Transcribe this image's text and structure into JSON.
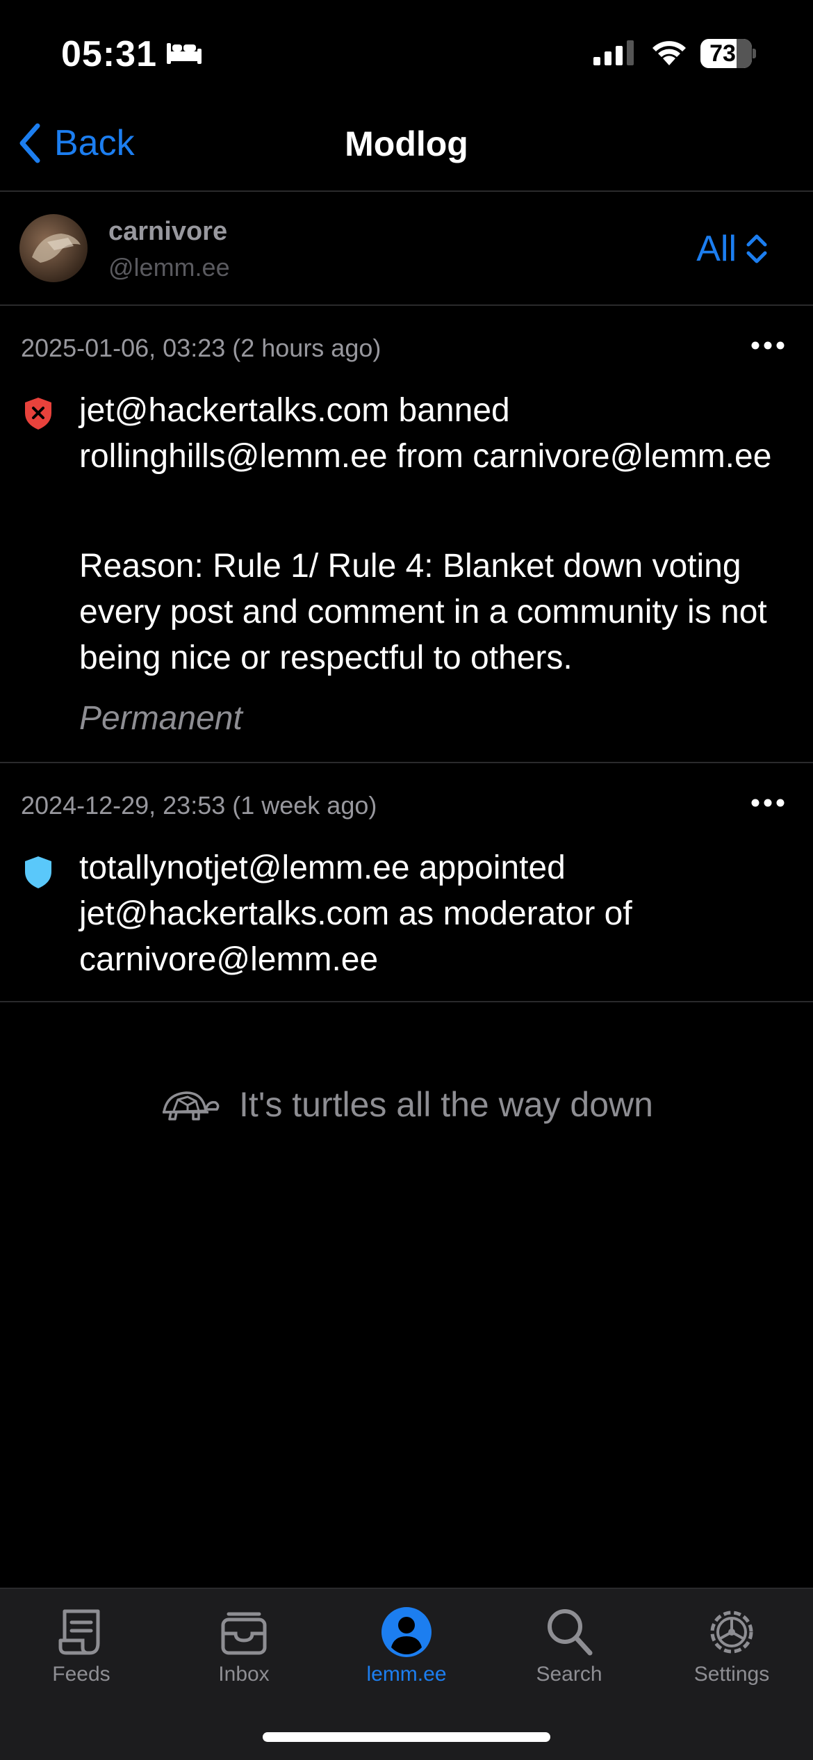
{
  "status_bar": {
    "time": "05:31",
    "battery": "73"
  },
  "nav": {
    "back_label": "Back",
    "title": "Modlog"
  },
  "community": {
    "name": "carnivore",
    "instance": "@lemm.ee",
    "filter_label": "All"
  },
  "entries": [
    {
      "timestamp": "2025-01-06, 03:23 (2 hours ago)",
      "icon": "ban-shield-icon",
      "text": "jet@hackertalks.com banned rollinghills@lemm.ee from carnivore@lemm.ee",
      "reason": "Reason: Rule 1/ Rule 4: Blanket down voting every post and comment in a community is not being nice or respectful to others.",
      "duration": "Permanent"
    },
    {
      "timestamp": "2024-12-29, 23:53 (1 week ago)",
      "icon": "moderator-shield-icon",
      "text": "totallynotjet@lemm.ee appointed jet@hackertalks.com as moderator of carnivore@lemm.ee"
    }
  ],
  "feed_end": {
    "text": "It's turtles all the way down"
  },
  "tabs": [
    {
      "label": "Feeds",
      "icon": "feeds-icon"
    },
    {
      "label": "Inbox",
      "icon": "inbox-icon"
    },
    {
      "label": "lemm.ee",
      "icon": "profile-icon",
      "active": true
    },
    {
      "label": "Search",
      "icon": "search-icon"
    },
    {
      "label": "Settings",
      "icon": "settings-icon"
    }
  ],
  "colors": {
    "accent": "#1c7ef0",
    "ban": "#e8423c",
    "moderator": "#5ac8fa",
    "background": "#000000"
  }
}
